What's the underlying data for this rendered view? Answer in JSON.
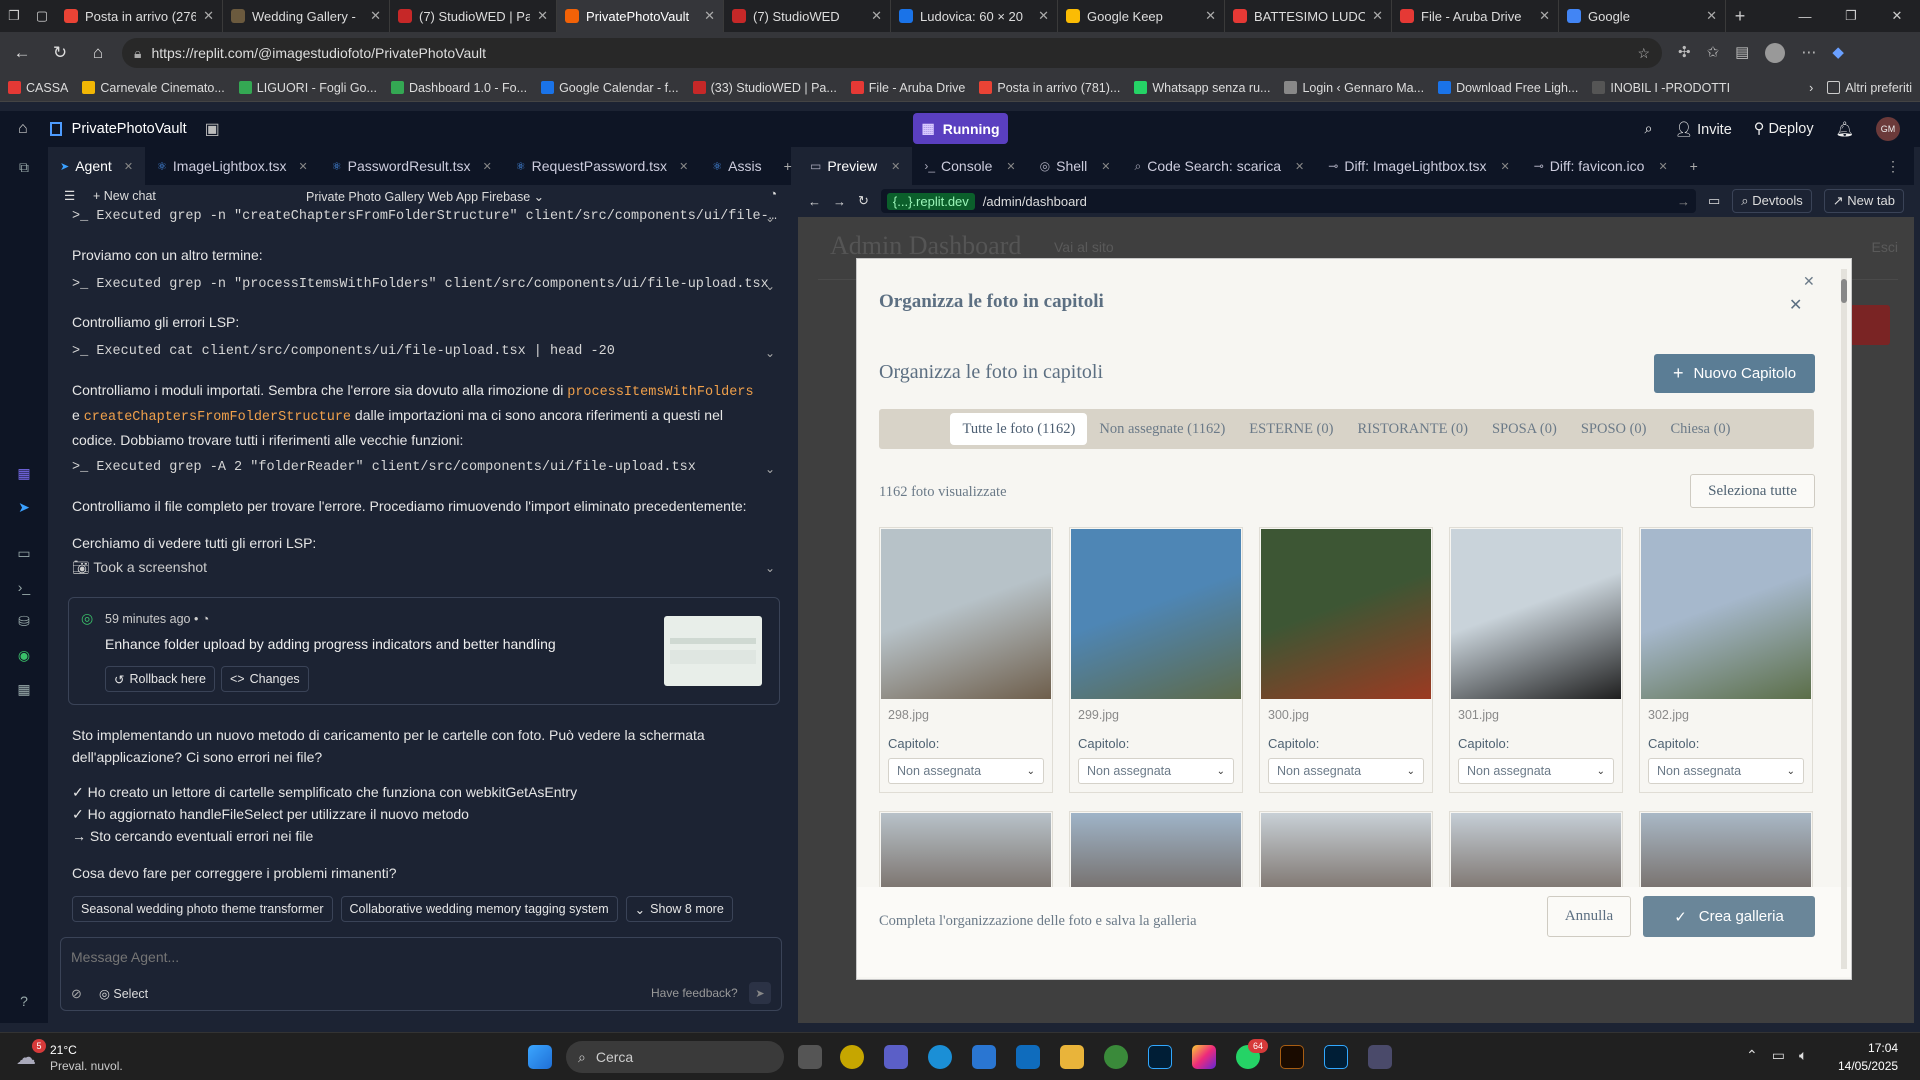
{
  "browser": {
    "tabs": [
      {
        "title": "Posta in arrivo (276",
        "color": "#ea4335"
      },
      {
        "title": "Wedding Gallery -",
        "color": "#6b5a3e"
      },
      {
        "title": "(7) StudioWED | Pa",
        "color": "#c62828"
      },
      {
        "title": "PrivatePhotoVault",
        "color": "#f26207"
      },
      {
        "title": "(7) StudioWED",
        "color": "#c62828"
      },
      {
        "title": "Ludovica: 60 × 20",
        "color": "#1a73e8"
      },
      {
        "title": "Google Keep",
        "color": "#fbbc04"
      },
      {
        "title": "BATTESIMO LUDO",
        "color": "#e53935"
      },
      {
        "title": "File - Aruba Drive",
        "color": "#e53935"
      },
      {
        "title": "Google",
        "color": "#4285f4"
      }
    ],
    "url": "https://replit.com/@imagestudiofoto/PrivatePhotoVault",
    "bookmarks": [
      "CASSA",
      "Carnevale Cinemato...",
      "LIGUORI - Fogli Go...",
      "Dashboard 1.0 - Fo...",
      "Google Calendar - f...",
      "(33) StudioWED | Pa...",
      "File - Aruba Drive",
      "Posta in arrivo (781)...",
      "Whatsapp senza ru...",
      "Login ‹ Gennaro Ma...",
      "Download Free Ligh...",
      "INOBIL I -PRODOTTI"
    ],
    "other_bookmarks": "Altri preferiti"
  },
  "replit": {
    "project": "PrivatePhotoVault",
    "status": "Running",
    "invite": "Invite",
    "deploy": "Deploy",
    "avatar": "GM"
  },
  "left_tabs": [
    "Agent",
    "ImageLightbox.tsx",
    "PasswordResult.tsx",
    "RequestPassword.tsx",
    "Assis"
  ],
  "agent": {
    "new_chat": "New chat",
    "chat_title": "Private Photo Gallery Web App Firebase",
    "cmd1": "Executed grep -n \"createChaptersFromFolderStructure\" client/src/components/ui/file-…",
    "t1": "Proviamo con un altro termine:",
    "cmd2": "Executed grep -n \"processItemsWithFolders\" client/src/components/ui/file-upload.tsx",
    "t2": "Controlliamo gli errori LSP:",
    "cmd3": "Executed cat client/src/components/ui/file-upload.tsx | head -20",
    "t3a": "Controlliamo i moduli importati. Sembra che l'errore sia dovuto alla rimozione di",
    "t3code1": "processItemsWithFolders",
    "t3b": "e",
    "t3code2": "createChaptersFromFolderStructure",
    "t3c": "dalle importazioni ma ci sono ancora riferimenti a questi nel",
    "t3d": "codice. Dobbiamo trovare tutti i riferimenti alle vecchie funzioni:",
    "cmd4": "Executed grep -A 2 \"folderReader\" client/src/components/ui/file-upload.tsx",
    "t4": "Controlliamo il file completo per trovare l'errore. Procediamo rimuovendo l'import eliminato precedentemente:",
    "t5": "Cerchiamo di vedere tutti gli errori LSP:",
    "screenshot": "Took a screenshot",
    "checkpoint": {
      "time": "59 minutes ago",
      "msg": "Enhance folder upload by adding progress indicators and better handling",
      "rollback": "Rollback here",
      "changes": "Changes"
    },
    "m1": "Sto implementando un nuovo metodo di caricamento per le cartelle con foto. Può vedere la schermata",
    "m2": "dell'applicazione? Ci sono errori nei file?",
    "c1": "✓ Ho creato un lettore di cartelle semplificato che funziona con webkitGetAsEntry",
    "c2": "✓ Ho aggiornato handleFileSelect per utilizzare il nuovo metodo",
    "c3": "→ Sto cercando eventuali errori nei file",
    "q": "Cosa devo fare per correggere i problemi rimanenti?",
    "sugg": [
      "Seasonal wedding photo theme transformer",
      "Collaborative wedding memory tagging system",
      "Show 8 more"
    ],
    "placeholder": "Message Agent...",
    "select": "Select",
    "feedback": "Have feedback?"
  },
  "right_tabs": [
    "Preview",
    "Console",
    "Shell",
    "Code Search: scarica",
    "Diff: ImageLightbox.tsx",
    "Diff: favicon.ico"
  ],
  "preview": {
    "domain": "{...}.replit.dev",
    "path": "/admin/dashboard",
    "devtools": "Devtools",
    "newtab": "New tab"
  },
  "site": {
    "title": "Admin Dashboard",
    "link": "Vai al sito",
    "exit": "Esci"
  },
  "modal": {
    "header": "Organizza le foto in capitoli",
    "subheader": "Organizza le foto in capitoli",
    "new_chapter": "Nuovo Capitolo",
    "filters": [
      "Tutte le foto (1162)",
      "Non assegnate (1162)",
      "ESTERNE (0)",
      "RISTORANTE (0)",
      "SPOSA (0)",
      "SPOSO (0)",
      "Chiesa (0)"
    ],
    "count": "1162 foto visualizzate",
    "select_all": "Seleziona tutte",
    "chapter_label": "Capitolo:",
    "select_value": "Non assegnata",
    "photos": [
      {
        "name": "298.jpg",
        "colors": [
          "#b7c2c8",
          "#6e5e4b"
        ]
      },
      {
        "name": "299.jpg",
        "colors": [
          "#4e86b5",
          "#5e6a4a"
        ]
      },
      {
        "name": "300.jpg",
        "colors": [
          "#3d5634",
          "#9c3a22"
        ]
      },
      {
        "name": "301.jpg",
        "colors": [
          "#c9d3da",
          "#1f1f1f"
        ]
      },
      {
        "name": "302.jpg",
        "colors": [
          "#a6b8cc",
          "#5b6e48"
        ]
      }
    ],
    "footer_text": "Completa l'organizzazione delle foto e salva la galleria",
    "cancel": "Annulla",
    "create": "Crea galleria"
  },
  "taskbar": {
    "weather_temp": "21°C",
    "weather_desc": "Preval. nuvol.",
    "search": "Cerca",
    "time": "17:04",
    "date": "14/05/2025",
    "badge1": "5",
    "badge2": "64"
  }
}
